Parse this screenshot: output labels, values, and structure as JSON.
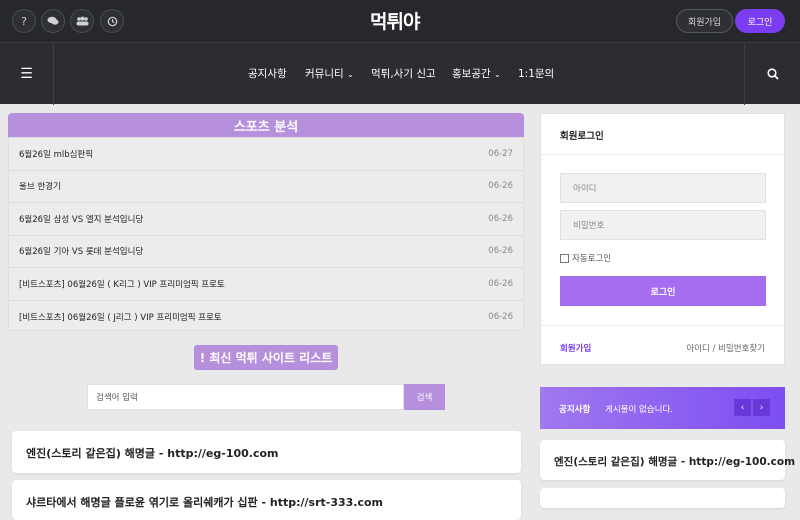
{
  "header": {
    "logo": "먹튀야",
    "join_label": "회원가입",
    "login_label": "로그인",
    "icons": [
      "help-icon",
      "chat-icon",
      "community-icon",
      "history-icon"
    ]
  },
  "nav": {
    "items": [
      {
        "label": "공지사항"
      },
      {
        "label": "커뮤니티",
        "caret": "⌄"
      },
      {
        "label": "먹튀,사기 신고"
      },
      {
        "label": "홍보공간",
        "caret": "⌄"
      },
      {
        "label": "1:1문의"
      }
    ]
  },
  "sports": {
    "heading": "스포츠 분석",
    "posts": [
      {
        "title": "6월26일 mlb심판픽",
        "date": "06-27"
      },
      {
        "title": "울브 한경기",
        "date": "06-26"
      },
      {
        "title": "6월26일 삼성 VS 엘지 분석입니당",
        "date": "06-26"
      },
      {
        "title": "6월26일 기아 VS 롯데 분석입니당",
        "date": "06-26"
      },
      {
        "title": "[비트스포츠] 06월26일 ( K리그 ) VIP 프리미엄픽 프로토",
        "date": "06-26"
      },
      {
        "title": "[비트스포츠] 06월26일 ( J리그 ) VIP 프리미엄픽 프로토",
        "date": "06-26"
      }
    ]
  },
  "latest": {
    "heading": "! 최신 먹튀 사이트 리스트",
    "search_placeholder": "검색어 입력",
    "search_button": "검색",
    "cards": [
      {
        "text": "엔진(스토리 같은집) 해명글 - http://eg-100.com"
      },
      {
        "text": "샤르타에서 해명글 플로윤 엮기로 올리쉐캐가 십판 - http://srt-333.com"
      }
    ]
  },
  "login_box": {
    "title": "회원로그인",
    "id_placeholder": "아이디",
    "pw_placeholder": "비밀번호",
    "auto_login": "자동로그인",
    "submit": "로그인",
    "join": "회원가입",
    "find": "아이디 / 비밀번호찾기"
  },
  "notice": {
    "label": "공지사항",
    "text": "게시물이 없습니다.",
    "prev": "‹",
    "next": "›"
  },
  "side_card": {
    "text": "엔진(스토리 같은집) 해명글 - http://eg-100.com"
  },
  "colors": {
    "accent": "#7a3df0",
    "heading_purple": "#b790dd",
    "topbar": "#26282c"
  }
}
